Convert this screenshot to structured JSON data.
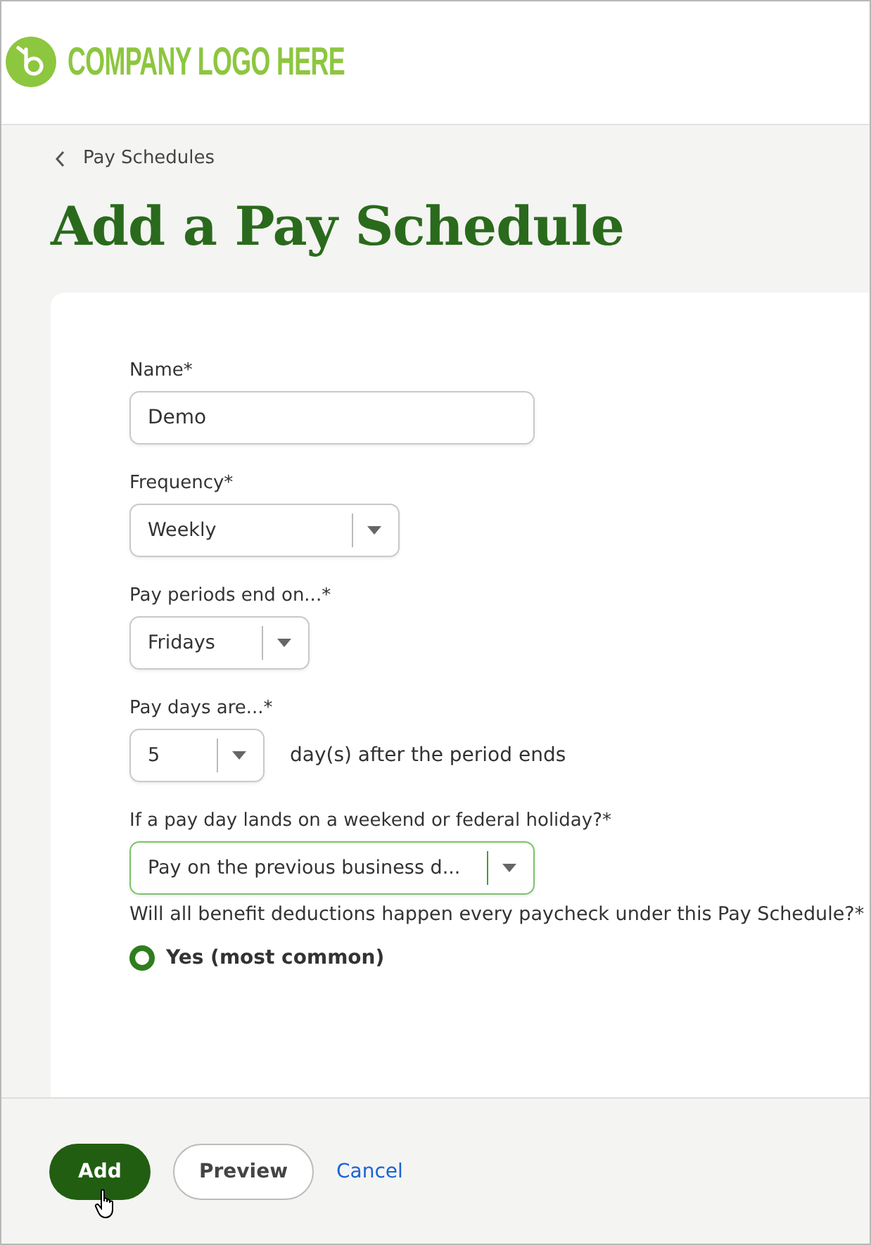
{
  "header": {
    "logo_text": "COMPANY LOGO HERE"
  },
  "breadcrumb": {
    "label": "Pay Schedules"
  },
  "title": "Add a Pay Schedule",
  "fields": [
    {
      "kind": "text",
      "label": "Name*",
      "value": "Demo",
      "focused": false
    },
    {
      "kind": "select",
      "label": "Frequency*",
      "value": "Weekly",
      "focused": false
    },
    {
      "kind": "select",
      "label": "Pay periods end on...*",
      "value": "Fridays",
      "focused": false
    },
    {
      "kind": "select",
      "label": "Pay days are...*",
      "value": "5",
      "suffix": "day(s) after the period ends",
      "focused": false
    },
    {
      "kind": "select",
      "label": "If a pay day lands on a weekend or federal holiday?*",
      "value": "Pay on the previous business d...",
      "focused": true
    }
  ],
  "benefits": {
    "question": "Will all benefit deductions happen every paycheck under this Pay Schedule?*",
    "options": [
      {
        "label": "Yes (most common)",
        "selected": true
      }
    ]
  },
  "footer": {
    "buttons": [
      {
        "kind": "primary",
        "label": "Add"
      },
      {
        "kind": "secondary",
        "label": "Preview"
      },
      {
        "kind": "link",
        "label": "Cancel"
      }
    ]
  }
}
